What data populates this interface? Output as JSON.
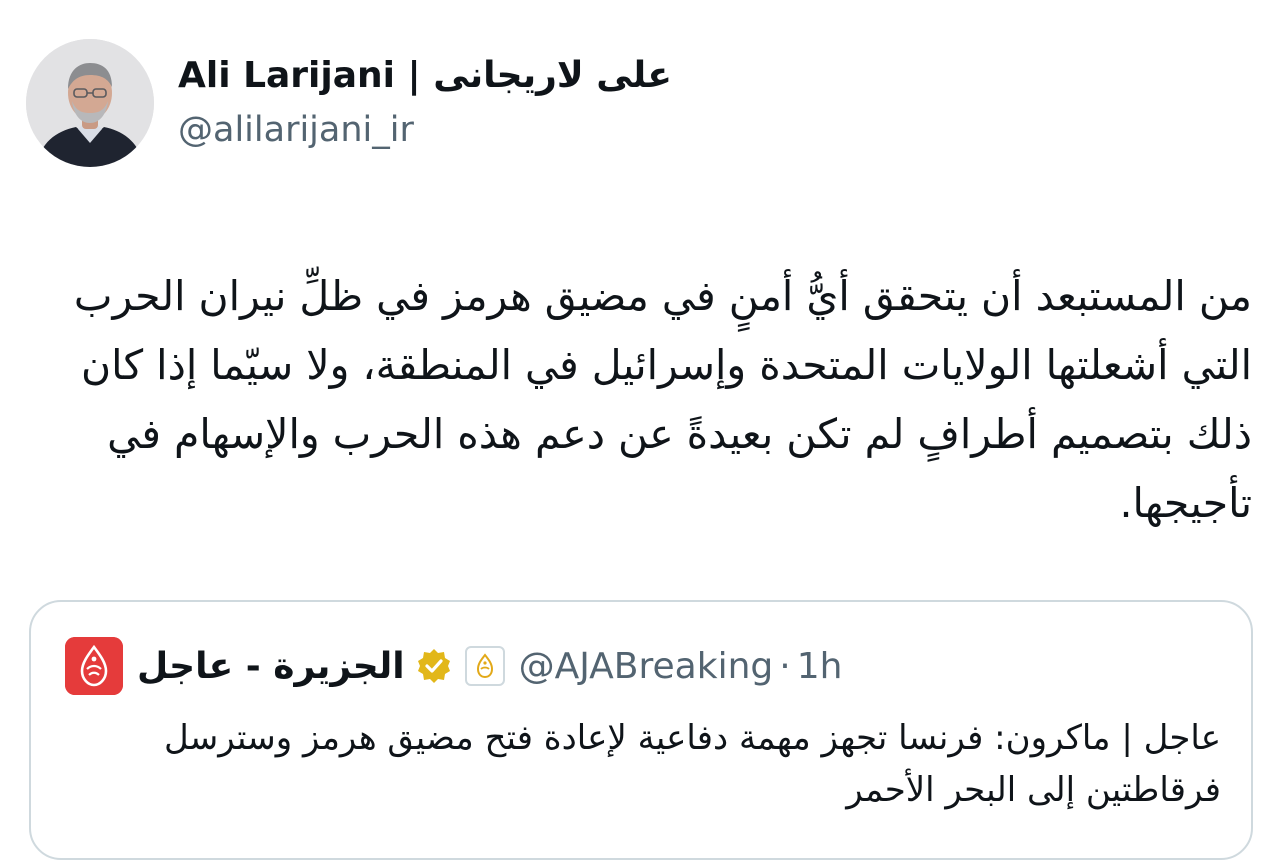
{
  "author": {
    "display_name": "Ali Larijani | علی لاریجانی",
    "handle": "@alilarijani_ir",
    "avatar_icon": "profile-photo"
  },
  "tweet": {
    "text": "من المستبعد أن يتحقق أيُّ أمنٍ في مضيق هرمز في ظلِّ نيران الحرب التي أشعلتها الولايات المتحدة وإسرائيل في المنطقة، ولا سيّما إذا كان ذلك بتصميم أطرافٍ لم تكن بعيدةً عن دعم هذه الحرب والإسهام في تأجيجها."
  },
  "quoted_tweet": {
    "display_name": "الجزيرة - عاجل",
    "handle": "@AJABreaking",
    "separator": "·",
    "time": "1h",
    "verified_icon": "gold-verified-badge",
    "affiliation_icon": "aljazeera-affiliate-badge",
    "text": "عاجل | ماكرون: فرنسا تجهز مهمة دفاعية لإعادة فتح مضيق هرمز وسترسل فرقاطتين إلى البحر الأحمر"
  },
  "colors": {
    "text_primary": "#0f1419",
    "text_secondary": "#536471",
    "border": "#cfd9de",
    "aljazeera_red": "#e53b3b",
    "verified_gold": "#e2b719"
  }
}
